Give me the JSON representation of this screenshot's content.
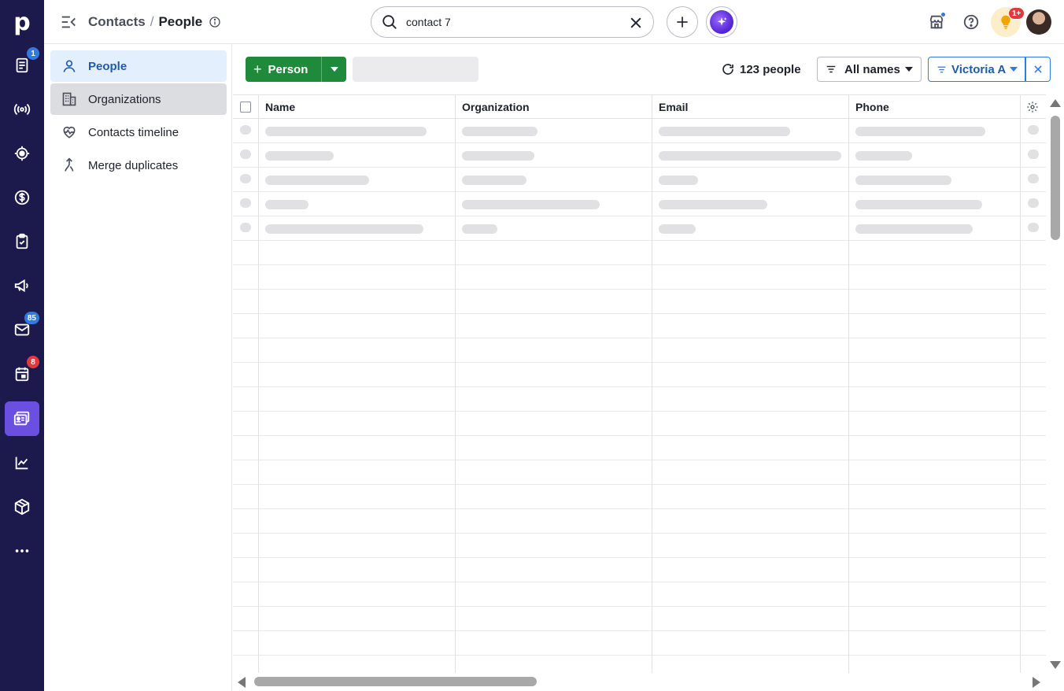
{
  "rail": {
    "logo": "p",
    "items": [
      {
        "name": "leads-icon",
        "badge": "1",
        "badge_color": "#317ae2"
      },
      {
        "name": "broadcast-icon",
        "badge": null
      },
      {
        "name": "target-icon",
        "badge": null
      },
      {
        "name": "dollar-icon",
        "badge": null
      },
      {
        "name": "clipboard-check-icon",
        "badge": null
      },
      {
        "name": "megaphone-icon",
        "badge": null
      },
      {
        "name": "mail-icon",
        "badge": "85",
        "badge_color": "#317ae2"
      },
      {
        "name": "calendar-icon",
        "badge": "8",
        "badge_color": "#e5383b"
      },
      {
        "name": "contacts-card-icon",
        "badge": null,
        "active": true
      },
      {
        "name": "chart-line-icon",
        "badge": null
      },
      {
        "name": "box-icon",
        "badge": null
      },
      {
        "name": "more-icon",
        "badge": null
      }
    ],
    "accent": "#6b4fe0",
    "background": "#1c1a4c"
  },
  "header": {
    "breadcrumb_parent": "Contacts",
    "breadcrumb_sep": "/",
    "breadcrumb_current": "People",
    "search_value": "contact 7",
    "tips_badge": "1+"
  },
  "subnav": {
    "items": [
      {
        "label": "People",
        "state": "active"
      },
      {
        "label": "Organizations",
        "state": "hover"
      },
      {
        "label": "Contacts timeline",
        "state": "normal"
      },
      {
        "label": "Merge duplicates",
        "state": "normal"
      }
    ]
  },
  "toolbar": {
    "add_label": "Person",
    "count_label": "123 people",
    "names_filter_label": "All names",
    "owner_filter_label": "Victoria A"
  },
  "table": {
    "columns": [
      "Name",
      "Organization",
      "Email",
      "Phone"
    ],
    "loading_rows": 5,
    "empty_rows": 18
  },
  "colors": {
    "primary_green": "#1f8a3b",
    "link_blue": "#317ae2",
    "active_nav_bg": "#e3effc"
  }
}
